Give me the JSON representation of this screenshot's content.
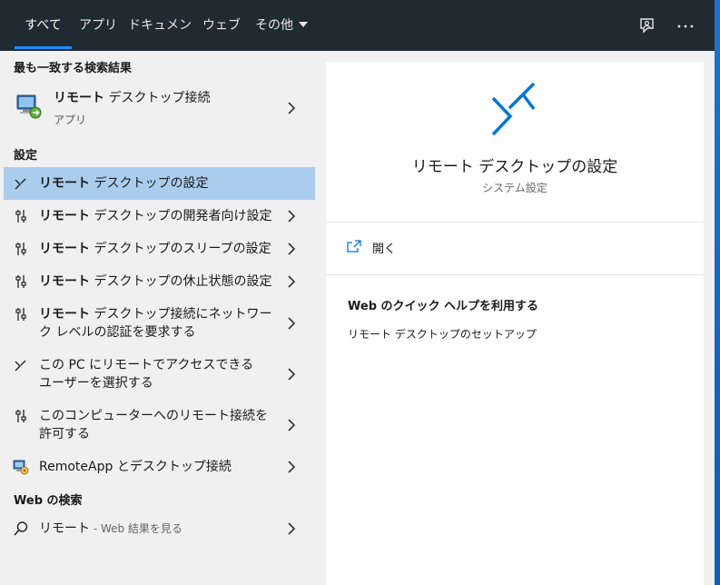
{
  "tabs": [
    {
      "label": "すべて"
    },
    {
      "label": "アプリ"
    },
    {
      "label": "ドキュメント"
    },
    {
      "label": "ウェブ"
    },
    {
      "label": "その他"
    }
  ],
  "left": {
    "best_match_title": "最も一致する検索結果",
    "best_match": {
      "bold": "リモート",
      "rest": " デスクトップ接続",
      "type": "アプリ"
    },
    "settings_title": "設定",
    "settings": [
      {
        "bold": "リモート",
        "rest": " デスクトップの設定",
        "icon": "remote-desktop-icon"
      },
      {
        "bold": "リモート",
        "rest": " デスクトップの開発者向け設定",
        "icon": "settings-sliders-icon"
      },
      {
        "bold": "リモート",
        "rest": " デスクトップのスリープの設定",
        "icon": "settings-sliders-icon"
      },
      {
        "bold": "リモート",
        "rest": " デスクトップの休止状態の設定",
        "icon": "settings-sliders-icon"
      },
      {
        "bold": "リモート",
        "rest": " デスクトップ接続にネットワーク レベルの認証を要求する",
        "icon": "settings-sliders-icon"
      },
      {
        "bold": "",
        "rest": "この PC にリモートでアクセスできるユーザーを選択する",
        "icon": "remote-desktop-icon"
      },
      {
        "bold": "",
        "rest": "このコンピューターへのリモート接続を許可する",
        "icon": "settings-sliders-icon"
      },
      {
        "bold": "",
        "rest": "RemoteApp とデスクトップ接続",
        "icon": "remoteapp-icon"
      }
    ],
    "web_title": "Web の検索",
    "web": {
      "query": "リモート",
      "suffix": " - Web 結果を見る"
    }
  },
  "preview": {
    "title": "リモート デスクトップの設定",
    "subtitle": "システム設定",
    "open_label": "開く",
    "help_title": "Web のクイック ヘルプを利用する",
    "help_link": "リモート デスクトップのセットアップ"
  },
  "colors": {
    "accent": "#0078d4",
    "topbar": "#1f2a33",
    "selected": "#aacdee"
  }
}
